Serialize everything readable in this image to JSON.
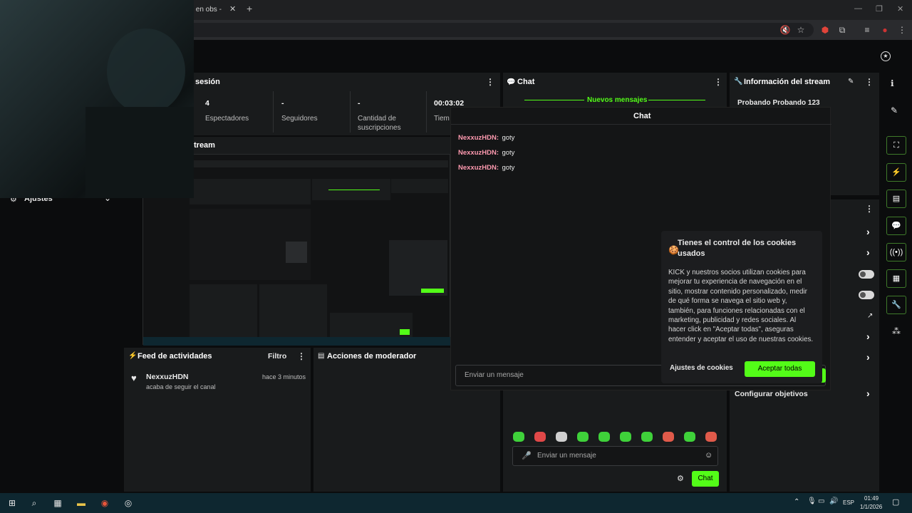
{
  "browser": {
    "tab_title": "ćk en obs -",
    "tab_close": "✕",
    "new_tab": "+",
    "win_min": "—",
    "win_max": "❐",
    "win_close": "✕"
  },
  "session_panel": {
    "title": "sesión",
    "stats": [
      {
        "value": "4",
        "label": "Espectadores"
      },
      {
        "value": "-",
        "label": "Seguidores"
      },
      {
        "value": "-",
        "label": "Cantidad de suscripciones"
      },
      {
        "value": "00:03:02",
        "label": "Tiem"
      }
    ]
  },
  "stream_panel": {
    "title": "tream"
  },
  "settings_item": {
    "label": "Ajustes"
  },
  "chat_panel": {
    "title": "Chat",
    "new_messages": "Nuevos mensajes",
    "input_placeholder": "Enviar un mensaje",
    "send_label": "Chat",
    "emote_count": 10
  },
  "stream_info": {
    "title": "Información del stream",
    "stream_title": "Probando Probando 123"
  },
  "chat_popup": {
    "title": "Chat",
    "messages": [
      {
        "user": "NexxuzHDN:",
        "text": "goty"
      },
      {
        "user": "NexxuzHDN:",
        "text": "goty"
      },
      {
        "user": "NexxuzHDN:",
        "text": "goty"
      }
    ],
    "input_placeholder": "Enviar un mensaje"
  },
  "cookie_banner": {
    "title": "Tienes el control de los cookies usados",
    "body": "KICK y nuestros socios utilizan cookies para mejorar tu experiencia de navegación en el sitio, mostrar contenido personalizado, medir de qué forma se navega el sitio web y, también, para funciones relacionadas con el marketing, publicidad y redes sociales. Al hacer click en \"Aceptar todas\", aseguras entender y aceptar el uso de nuestras cookies.",
    "settings_button": "Ajustes de cookies",
    "accept_button": "Aceptar todas"
  },
  "goals": {
    "label": "Configurar objetivos"
  },
  "activity_feed": {
    "title": "Feed de actividades",
    "filter": "Filtro",
    "items": [
      {
        "user": "NexxuzHDN",
        "action": "acaba de seguir el canal",
        "time": "hace 3 minutos"
      }
    ]
  },
  "mod_actions": {
    "title": "Acciones de moderador"
  },
  "taskbar": {
    "language": "ESP",
    "time": "01:49",
    "date": "1/1/2026"
  },
  "colors": {
    "accent": "#53fc18",
    "panel": "#191b1c",
    "background": "#0b0c0d"
  }
}
